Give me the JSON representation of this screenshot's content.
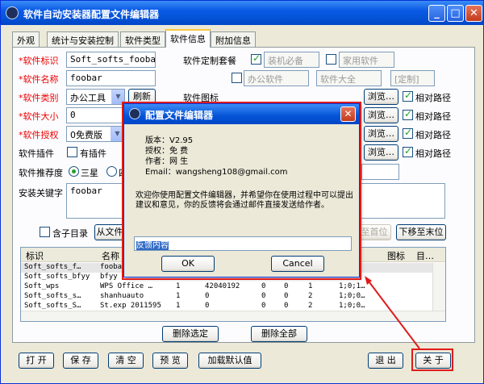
{
  "window": {
    "title": "软件自动安装器配置文件编辑器"
  },
  "tabs": [
    "外观",
    "统计与安装控制",
    "软件类型",
    "软件信息",
    "附加信息"
  ],
  "form": {
    "software_id_label": "*软件标识",
    "software_id_value": "Soft_softs_foobar",
    "software_name_label": "*软件名称",
    "software_name_value": "foobar",
    "software_category_label": "*软件类别",
    "software_category_value": "办公工具",
    "refresh_label": "刷新",
    "software_size_label": "*软件大小",
    "software_size_value": "0",
    "software_license_label": "*软件授权",
    "software_license_value": "0免费版",
    "plugin_label": "软件插件",
    "has_plugin_label": "有插件",
    "recommend_label": "软件推荐度",
    "recommend_options": [
      "三星",
      "四"
    ],
    "keyword_label": "安装关键字",
    "keyword_value": "foobar",
    "custom_pack_label": "软件定制套餐",
    "custom_pack_options": [
      "装机必备",
      "家用软件",
      "办公软件",
      "软件大全",
      "[定制]"
    ],
    "icon_label": "软件图标",
    "browse_label": "浏览…",
    "relative_path_label": "相对路径",
    "subdir_label": "含子目录",
    "from_file_label": "从文件",
    "move_top_label": "至首位",
    "move_bottom_label": "下移至末位"
  },
  "table": {
    "headers": [
      "标识",
      "名称",
      "图标",
      "目…"
    ],
    "rows": [
      [
        "Soft_softs_f…",
        "fooba",
        "",
        "",
        "",
        "",
        "",
        "",
        ""
      ],
      [
        "Soft_softs_bfyy",
        "bfyy",
        "",
        "",
        "",
        "",
        "",
        "",
        ""
      ],
      [
        "Soft_wps",
        "WPS Office …",
        "1",
        "42040192",
        "0",
        "0",
        "1",
        "1;0;1…",
        ""
      ],
      [
        "Soft_softs_s…",
        "shanhuauto",
        "1",
        "0",
        "0",
        "0",
        "2",
        "1;0;0…",
        ""
      ],
      [
        "Soft_softs_S…",
        "St.exp 2011595",
        "1",
        "0",
        "0",
        "0",
        "2",
        "1;0;0…",
        ""
      ]
    ]
  },
  "middle_buttons": {
    "delete_selected": "删除选定",
    "delete_all": "删除全部"
  },
  "bottom_buttons": {
    "open": "打 开",
    "save": "保 存",
    "clear": "清 空",
    "preview": "预 览",
    "load_default": "加载默认值",
    "exit": "退 出",
    "about": "关 于"
  },
  "dialog": {
    "title": "配置文件编辑器",
    "version": "版本：V2.95",
    "license": "授权：免 费",
    "author": "作者：网 生",
    "email": "Email：wangsheng108@gmail.com",
    "message": "欢迎你使用配置文件编辑器，并希望你在使用过程中可以提出建议和意见，你的反馈将会通过邮件直接发送给作者。",
    "feedback_placeholder": "反馈内容",
    "ok_label": "OK",
    "cancel_label": "Cancel"
  },
  "colors": {
    "annotation_red": "#e01b1b",
    "required_red": "#e00000",
    "xp_blue": "#0553d6"
  }
}
